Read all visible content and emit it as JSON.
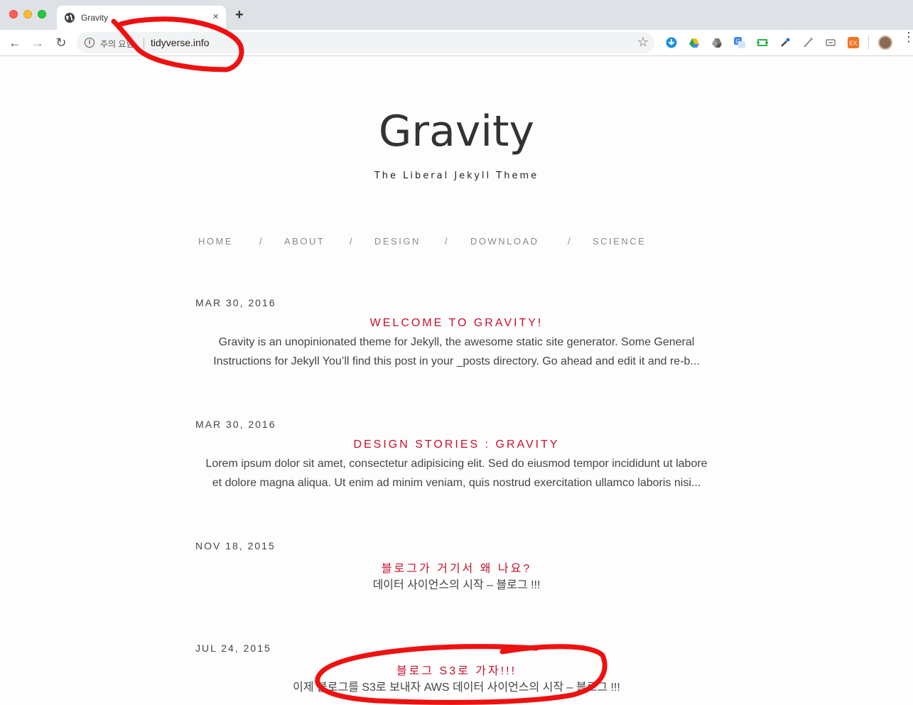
{
  "browser": {
    "tab_title": "Gravity",
    "tab_close": "×",
    "new_tab": "+",
    "back": "←",
    "forward": "→",
    "reload": "↻",
    "insecure_label": "주의 요함",
    "url": "tidyverse.info",
    "bookmark": "☆",
    "menu": "⋮"
  },
  "site": {
    "title": "Gravity",
    "subtitle": "The Liberal Jekyll Theme"
  },
  "nav": {
    "items": [
      "HOME",
      "ABOUT",
      "DESIGN",
      "DOWNLOAD",
      "SCIENCE"
    ],
    "separator": "/"
  },
  "posts": [
    {
      "date": "MAR 30, 2016",
      "title": "WELCOME TO GRAVITY!",
      "excerpt_line1": "Gravity is an unopinionated theme for Jekyll, the awesome static site generator. Some General",
      "excerpt_line2": "Instructions for Jekyll You’ll find this post in your _posts directory. Go ahead and edit it and re-b..."
    },
    {
      "date": "MAR 30, 2016",
      "title": "DESIGN STORIES : GRAVITY",
      "excerpt_line1": "Lorem ipsum dolor sit amet, consectetur adipisicing elit. Sed do eiusmod tempor incididunt ut labore",
      "excerpt_line2": "et dolore magna aliqua. Ut enim ad minim veniam, quis nostrud exercitation ullamco laboris nisi..."
    },
    {
      "date": "NOV 18, 2015",
      "title": "블로그가 거기서 왜 나요?",
      "excerpt_line1": "데이터 사이언스의 시작 – 블로그 !!!",
      "excerpt_line2": ""
    },
    {
      "date": "JUL 24, 2015",
      "title": "블로그 S3로 가자!!!",
      "excerpt_line1": "이제 블로그를 S3로 보내자 AWS 데이터 사이언스의 시작 – 블로그 !!!",
      "excerpt_line2": ""
    }
  ],
  "colors": {
    "accent": "#c8102e",
    "annotation": "#ee1111"
  }
}
